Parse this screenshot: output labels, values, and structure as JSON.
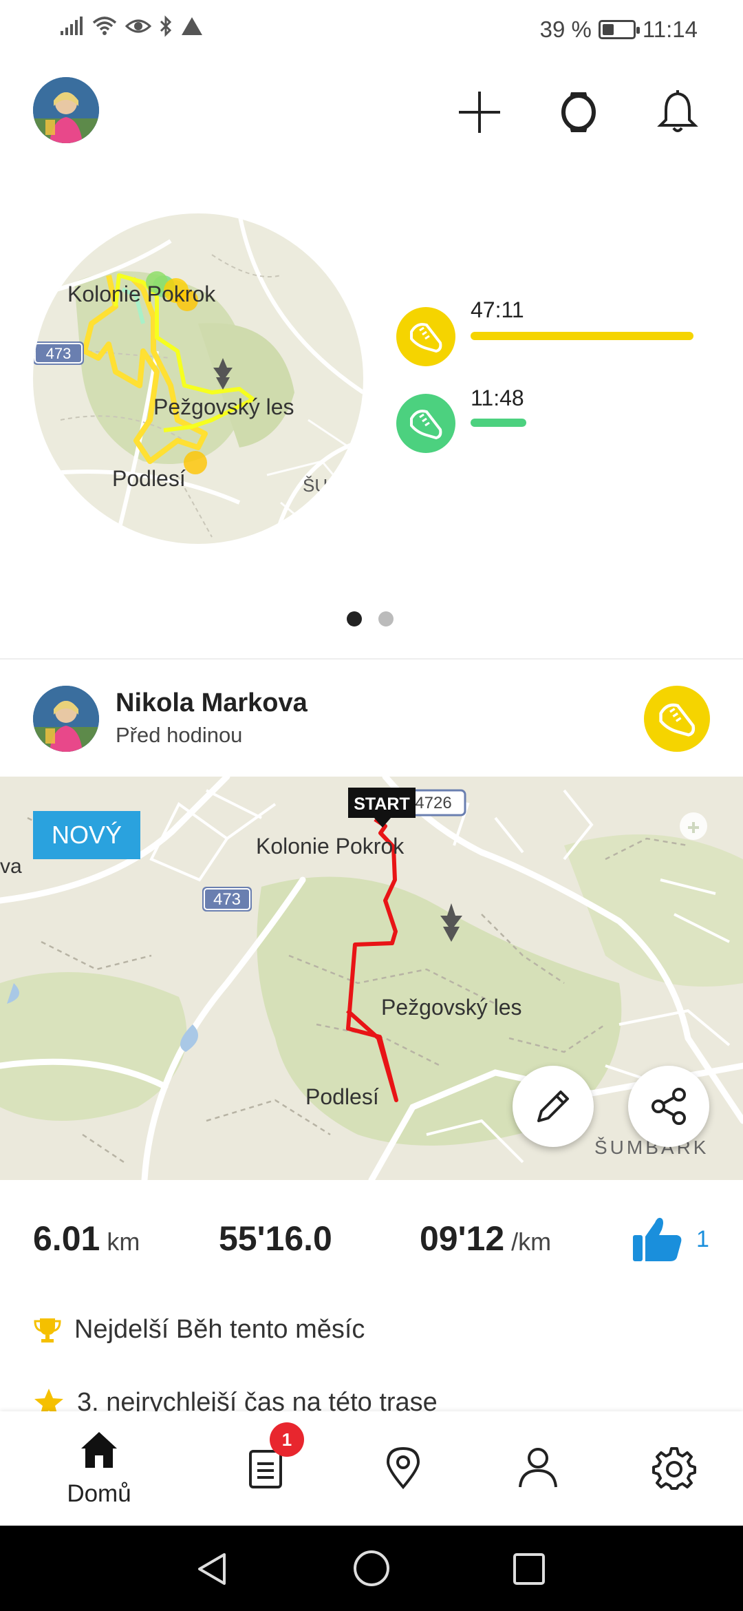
{
  "status_bar": {
    "battery_text": "39 %",
    "battery_level": 0.39,
    "time": "11:14",
    "icons": [
      "signal-icon",
      "wifi-icon",
      "eye-icon",
      "bluetooth-icon",
      "alert-icon"
    ]
  },
  "top_bar": {
    "actions": [
      "add-icon",
      "watch-icon",
      "bell-icon"
    ]
  },
  "summary": {
    "map_labels": {
      "place1": "Kolonie Pokrok",
      "road": "473",
      "forest": "Pežgovský les",
      "place2": "Podlesí",
      "place3": "ŠU"
    },
    "activities": [
      {
        "icon": "running-shoe-icon",
        "duration": "47:11",
        "color": "#f5d400",
        "bar_fraction": 1.0
      },
      {
        "icon": "walking-shoe-icon",
        "duration": "11:48",
        "color": "#4cd17f",
        "bar_fraction": 0.25
      }
    ],
    "page_count": 2,
    "active_page": 0
  },
  "feed": {
    "user_name": "Nikola Markova",
    "posted_time": "Před hodinou",
    "sport_icon": "running-shoe-icon",
    "map": {
      "badge": "NOVÝ",
      "start_label": "START",
      "road_4726": "4726",
      "road_473": "473",
      "place1": "Kolonie Pokrok",
      "forest": "Pežgovský les",
      "place2": "Podlesí",
      "place3": "ŠUMBARK",
      "edge_text": "va"
    },
    "stats": {
      "distance_value": "6.01",
      "distance_unit": "km",
      "duration_value": "55'16.0",
      "pace_value": "09'12",
      "pace_unit": "/km",
      "likes": "1"
    },
    "achievements": [
      {
        "icon": "trophy-icon",
        "text": "Nejdelší Běh tento měsíc"
      },
      {
        "icon": "star-icon",
        "text": "3. nejrychlejší čas na této trase"
      }
    ]
  },
  "bottom_nav": {
    "items": [
      {
        "icon": "home-icon",
        "label": "Domů"
      },
      {
        "icon": "diary-icon",
        "label": "",
        "badge": "1"
      },
      {
        "icon": "map-pin-icon",
        "label": ""
      },
      {
        "icon": "profile-icon",
        "label": ""
      },
      {
        "icon": "settings-icon",
        "label": ""
      }
    ]
  },
  "colors": {
    "accent_yellow": "#f5d400",
    "accent_green": "#4cd17f",
    "badge_blue": "#2aa2de",
    "route_red": "#e81416",
    "like_blue": "#1a8fdc"
  }
}
